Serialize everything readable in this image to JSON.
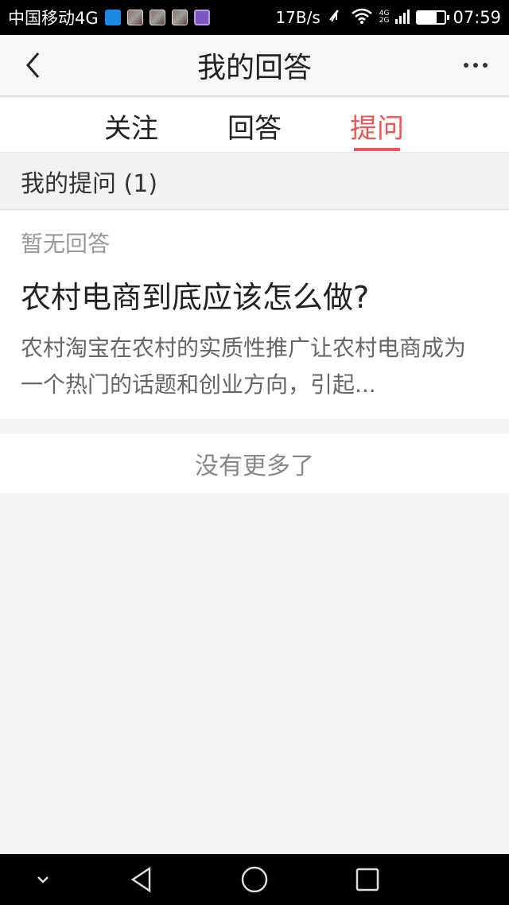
{
  "status_bar": {
    "carrier": "中国移动4G",
    "net_speed": "17B/s",
    "signal_small_top": "4G",
    "signal_small_bottom": "2G",
    "time": "07:59",
    "battery_level": 0.7
  },
  "app_bar": {
    "title": "我的回答",
    "back_icon": "chevron-left-icon",
    "more_icon": "more-dots-icon"
  },
  "tabs": [
    {
      "label": "关注",
      "active": false
    },
    {
      "label": "回答",
      "active": false
    },
    {
      "label": "提问",
      "active": true
    }
  ],
  "accent_color": "#f05454",
  "section": {
    "header": "我的提问 (1)"
  },
  "question": {
    "status": "暂无回答",
    "title": "农村电商到底应该怎么做?",
    "description": "农村淘宝在农村的实质性推广让农村电商成为一个热门的话题和创业方向，引起..."
  },
  "footer": {
    "no_more": "没有更多了"
  },
  "nav_bar": {
    "icons": [
      "chevron-down-icon",
      "back-triangle-icon",
      "home-circle-icon",
      "recents-square-icon"
    ]
  }
}
